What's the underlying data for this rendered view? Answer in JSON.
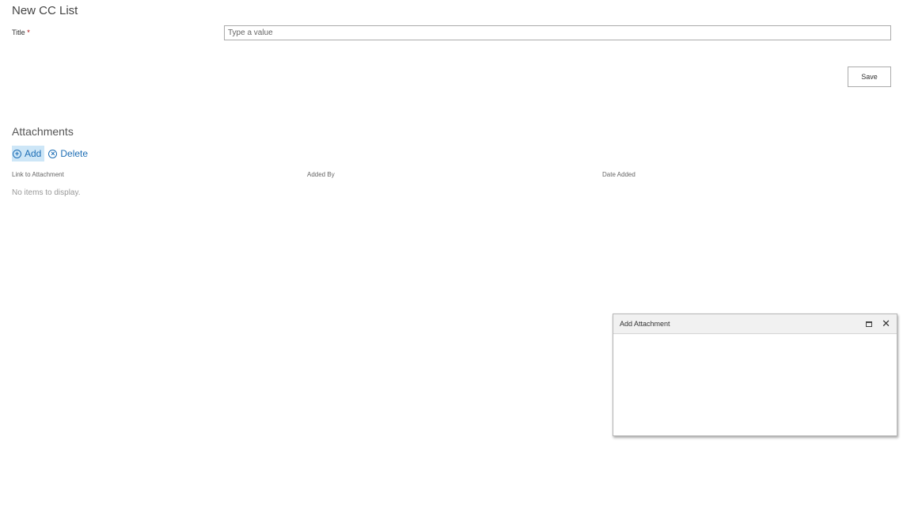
{
  "form": {
    "title": "New CC List",
    "fields": [
      {
        "label": "Title",
        "required_marker": "*",
        "value": "",
        "placeholder": "Type a value"
      }
    ],
    "save_label": "Save"
  },
  "attachments": {
    "section_title": "Attachments",
    "commands": [
      {
        "label": "Add",
        "icon": "plus-circle-icon"
      },
      {
        "label": "Delete",
        "icon": "x-circle-icon"
      }
    ],
    "columns": [
      "Link to Attachment",
      "Added By",
      "Date Added"
    ],
    "empty_message": "No items to display."
  },
  "dialog": {
    "title": "Add Attachment",
    "controls": [
      "maximize-icon",
      "close-icon"
    ]
  },
  "colors": {
    "link_blue": "#1e6eb5",
    "active_command_bg": "#cde6f7",
    "required_red": "#a80000"
  }
}
